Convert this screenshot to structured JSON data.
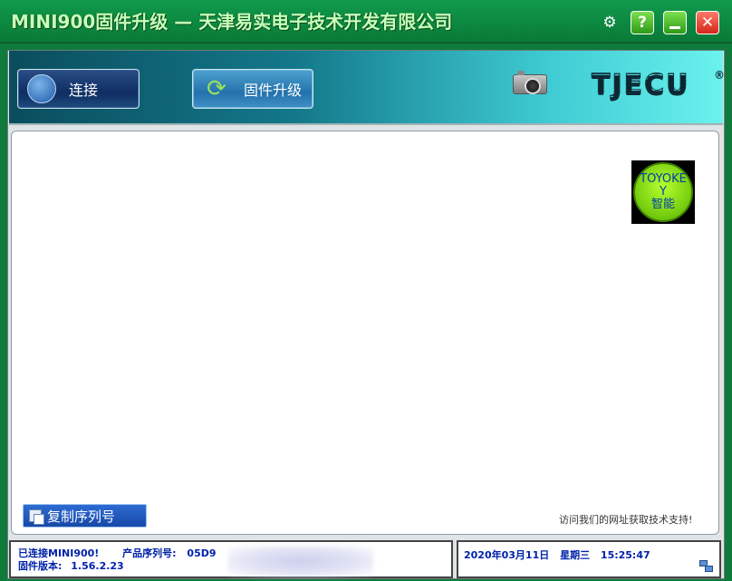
{
  "window": {
    "title": "MINI900固件升级 — 天津易实电子技术开发有限公司",
    "help_label": "?",
    "close_label": "✕"
  },
  "toolbar": {
    "connect_label": "连接",
    "upgrade_label": "固件升级",
    "logo_text": "TJECU",
    "logo_reg": "®"
  },
  "content": {
    "badge_line1": "TOYOKE",
    "badge_line2": "Y",
    "badge_line3": "智能",
    "copy_serial_label": "复制序列号",
    "support_text": "访问我们的网址获取技术支持!"
  },
  "status": {
    "connected_text": "已连接MINI900!",
    "serial_label": "产品序列号:",
    "serial_value": "05D9",
    "firmware_label": "固件版本:",
    "firmware_value": "1.56.2.23",
    "date": "2020年03月11日",
    "weekday": "星期三",
    "time": "15:25:47"
  }
}
